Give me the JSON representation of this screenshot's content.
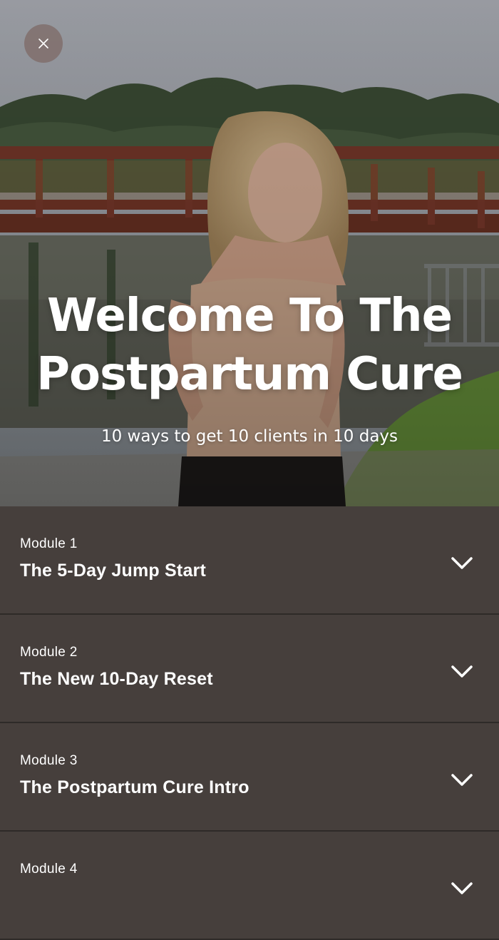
{
  "hero": {
    "title_line1": "Welcome To The",
    "title_line2": "Postpartum Cure",
    "subtitle": "10 ways to get 10 clients in 10 days"
  },
  "close": {
    "icon": "close-icon"
  },
  "modules": [
    {
      "label": "Module 1",
      "title": "The 5-Day Jump Start",
      "icon": "chevron-down-icon"
    },
    {
      "label": "Module 2",
      "title": "The New 10-Day Reset",
      "icon": "chevron-down-icon"
    },
    {
      "label": "Module 3",
      "title": "The Postpartum Cure Intro",
      "icon": "chevron-down-icon"
    },
    {
      "label": "Module 4",
      "title": "",
      "icon": "chevron-down-icon"
    }
  ],
  "colors": {
    "panel_bg": "#463f3c",
    "divider": "#2e2a28",
    "text": "#ffffff"
  }
}
